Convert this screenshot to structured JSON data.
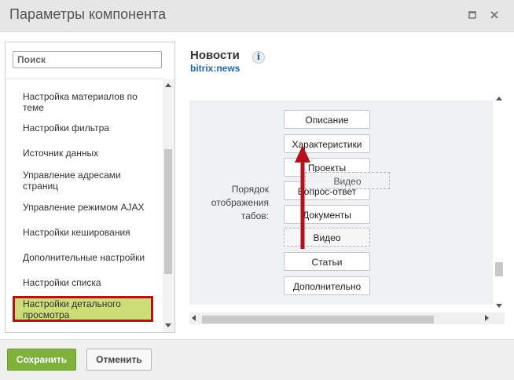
{
  "window": {
    "title": "Параметры компонента"
  },
  "sidebar": {
    "search": {
      "placeholder": "Поиск"
    },
    "items": [
      {
        "label": "Настройка материалов по теме"
      },
      {
        "label": "Настройки фильтра"
      },
      {
        "label": "Источник данных"
      },
      {
        "label": "Управление адресами страниц"
      },
      {
        "label": "Управление режимом AJAX"
      },
      {
        "label": "Настройки кеширования"
      },
      {
        "label": "Дополнительные настройки"
      },
      {
        "label": "Настройки списка"
      },
      {
        "label": "Настройки детального просмотра",
        "active": true
      }
    ]
  },
  "component": {
    "name": "Новости",
    "id": "bitrix:news",
    "info_icon": "info-icon"
  },
  "tab_order": {
    "label": "Порядок отображения табов:",
    "tabs": [
      {
        "label": "Описание"
      },
      {
        "label": "Характеристики"
      },
      {
        "label": "Проекты"
      },
      {
        "label": "Вопрос-ответ"
      },
      {
        "label": "Документы"
      },
      {
        "label": "Видео",
        "placeholder": true
      },
      {
        "label": "Статьи"
      },
      {
        "label": "Дополнительно"
      }
    ],
    "dragging_label": "Видео"
  },
  "footer": {
    "save_label": "Сохранить",
    "cancel_label": "Отменить"
  },
  "colors": {
    "save_button": "#7fb13b",
    "active_item_bg": "#ccdc77",
    "highlight_border": "#b4121a",
    "arrow": "#b4121a",
    "component_id": "#2067b0"
  }
}
